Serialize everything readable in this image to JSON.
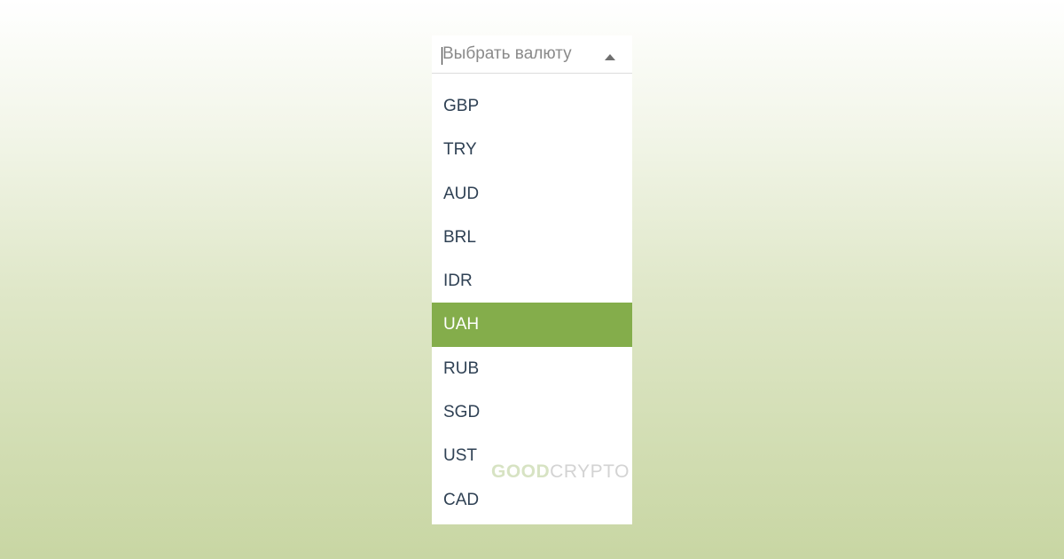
{
  "select": {
    "placeholder": "Выбрать валюту",
    "options": [
      "GBP",
      "TRY",
      "AUD",
      "BRL",
      "IDR",
      "UAH",
      "RUB",
      "SGD",
      "UST",
      "CAD"
    ],
    "highlighted": "UAH"
  },
  "watermark": {
    "part1": "GOOD",
    "part2": "CRYPTO"
  },
  "colors": {
    "highlight": "#84ad4b",
    "option_text": "#2f4154",
    "background_top": "#ffffff",
    "background_bottom": "#c8d6a3"
  },
  "icons": {
    "dropdown_toggle": "chevron-up-icon"
  }
}
